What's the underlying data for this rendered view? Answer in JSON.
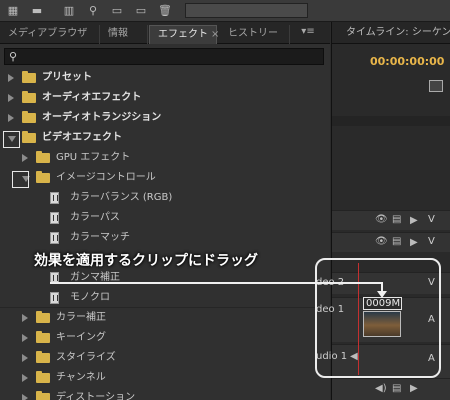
{
  "toolbar": {
    "icons": [
      "list-view-icon",
      "list-icon",
      "library-icon",
      "search-icon",
      "folder-icon",
      "folder-icon",
      "trash-icon"
    ]
  },
  "tabs": [
    {
      "label": "メディアブラウザ"
    },
    {
      "label": "情報"
    },
    {
      "label": "エフェクト",
      "active": true,
      "close": "×"
    },
    {
      "label": "ヒストリー"
    }
  ],
  "panel_menu": "▾≡",
  "search": {
    "value": "",
    "placeholder": ""
  },
  "tree": [
    {
      "label": "プリセット",
      "type": "folder",
      "bold": true,
      "expanded": false
    },
    {
      "label": "オーディオエフェクト",
      "type": "folder",
      "bold": true,
      "expanded": false
    },
    {
      "label": "オーディオトランジション",
      "type": "folder",
      "bold": true,
      "expanded": false
    },
    {
      "label": "ビデオエフェクト",
      "type": "folder",
      "bold": true,
      "expanded": true
    },
    {
      "label": "GPU エフェクト",
      "type": "folder",
      "bold": false,
      "expanded": false
    },
    {
      "label": "イメージコントロール",
      "type": "folder",
      "bold": false,
      "expanded": true
    },
    {
      "label": "カラーバランス (RGB)",
      "type": "effect"
    },
    {
      "label": "カラーパス",
      "type": "effect"
    },
    {
      "label": "カラーマッチ",
      "type": "effect"
    },
    {
      "label": "",
      "type": "effect"
    },
    {
      "label": "ガンマ補正",
      "type": "effect"
    },
    {
      "label": "モノクロ",
      "type": "effect"
    },
    {
      "label": "カラー補正",
      "type": "folder",
      "bold": false,
      "expanded": false
    },
    {
      "label": "キーイング",
      "type": "folder",
      "bold": false,
      "expanded": false
    },
    {
      "label": "スタイライズ",
      "type": "folder",
      "bold": false,
      "expanded": false
    },
    {
      "label": "チャンネル",
      "type": "folder",
      "bold": false,
      "expanded": false
    },
    {
      "label": "ディストーション",
      "type": "folder",
      "bold": false,
      "expanded": false
    }
  ],
  "timeline": {
    "tab_label": "タイムライン: シーケン",
    "timecode": "00:00:00:00",
    "tracks": [
      {
        "name": "deo 2"
      },
      {
        "name": "deo 1"
      },
      {
        "name": "udio 1"
      }
    ],
    "clip_label": "0009M",
    "track_side_labels": [
      "V",
      "V",
      "V",
      "A",
      "A"
    ]
  },
  "callout": {
    "text": "効果を適用するクリップにドラッグ"
  }
}
